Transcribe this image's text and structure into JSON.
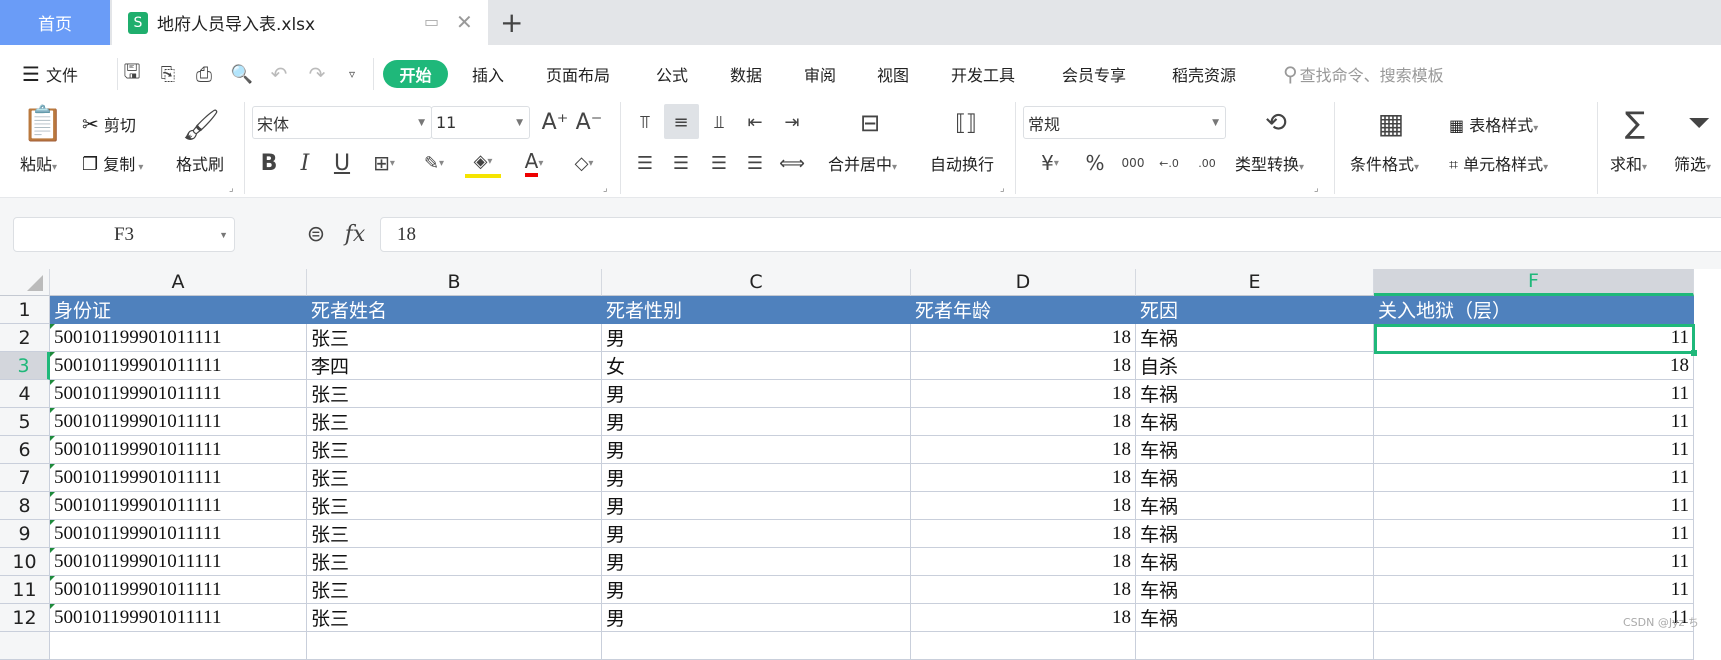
{
  "tabs": {
    "home": "首页",
    "file_title": "地府人员导入表.xlsx",
    "file_icon": "S",
    "new_tab": "+"
  },
  "menu": {
    "file": "文件",
    "items": [
      "开始",
      "插入",
      "页面布局",
      "公式",
      "数据",
      "审阅",
      "视图",
      "开发工具",
      "会员专享",
      "稻壳资源"
    ],
    "search_placeholder": "查找命令、搜索模板"
  },
  "ribbon": {
    "paste": "粘贴",
    "cut": "剪切",
    "copy": "复制",
    "format_painter": "格式刷",
    "font_name": "宋体",
    "font_size": "11",
    "merge_center": "合并居中",
    "wrap_text": "自动换行",
    "number_format": "常规",
    "type_convert": "类型转换",
    "conditional_format": "条件格式",
    "table_style": "表格样式",
    "cell_style": "单元格样式",
    "sum": "求和",
    "filter": "筛选",
    "bold": "B",
    "italic": "I",
    "underline": "U",
    "currency": "¥",
    "percent": "%",
    "thousands": "000",
    "inc_decimal": "←.0",
    "dec_decimal": ".00"
  },
  "formula_bar": {
    "name_box": "F3",
    "fx": "fx",
    "value": "18"
  },
  "columns": [
    "A",
    "B",
    "C",
    "D",
    "E",
    "F"
  ],
  "grid": {
    "rows": [
      {
        "n": "1",
        "cells": [
          "身份证",
          "死者姓名",
          "死者性别",
          "死者年龄",
          "死因",
          "关入地狱（层）"
        ]
      },
      {
        "n": "2",
        "cells": [
          "500101199901011111",
          "张三",
          "男",
          "18",
          "车祸",
          "11"
        ]
      },
      {
        "n": "3",
        "cells": [
          "500101199901011111",
          "李四",
          "女",
          "18",
          "自杀",
          "18"
        ]
      },
      {
        "n": "4",
        "cells": [
          "500101199901011111",
          "张三",
          "男",
          "18",
          "车祸",
          "11"
        ]
      },
      {
        "n": "5",
        "cells": [
          "500101199901011111",
          "张三",
          "男",
          "18",
          "车祸",
          "11"
        ]
      },
      {
        "n": "6",
        "cells": [
          "500101199901011111",
          "张三",
          "男",
          "18",
          "车祸",
          "11"
        ]
      },
      {
        "n": "7",
        "cells": [
          "500101199901011111",
          "张三",
          "男",
          "18",
          "车祸",
          "11"
        ]
      },
      {
        "n": "8",
        "cells": [
          "500101199901011111",
          "张三",
          "男",
          "18",
          "车祸",
          "11"
        ]
      },
      {
        "n": "9",
        "cells": [
          "500101199901011111",
          "张三",
          "男",
          "18",
          "车祸",
          "11"
        ]
      },
      {
        "n": "10",
        "cells": [
          "500101199901011111",
          "张三",
          "男",
          "18",
          "车祸",
          "11"
        ]
      },
      {
        "n": "11",
        "cells": [
          "500101199901011111",
          "张三",
          "男",
          "18",
          "车祸",
          "11"
        ]
      },
      {
        "n": "12",
        "cells": [
          "500101199901011111",
          "张三",
          "男",
          "18",
          "车祸",
          "11"
        ]
      }
    ]
  },
  "watermark": "CSDN @Jyz ち",
  "colors": {
    "accent": "#1fb87a",
    "header_fill": "#4f81bd",
    "home_tab": "#6a9cf7"
  }
}
